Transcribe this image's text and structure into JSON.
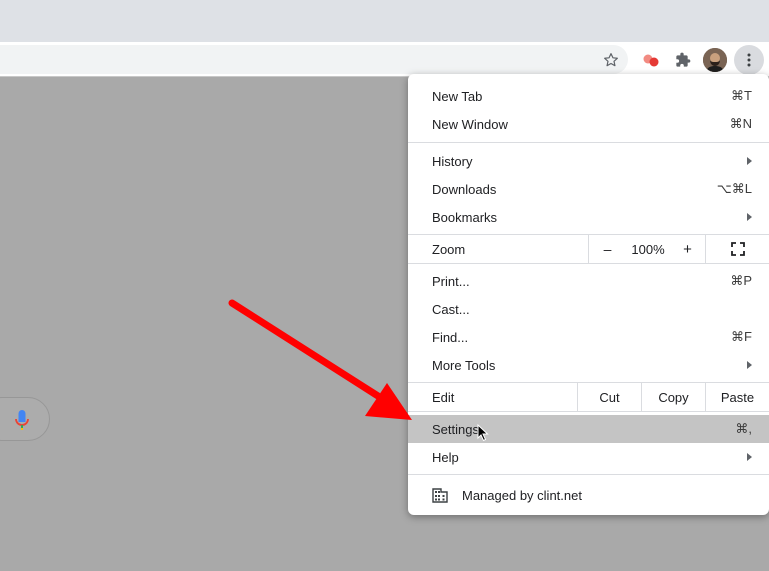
{
  "toolbar": {
    "icons": [
      "star-icon",
      "extension-red-icon",
      "puzzle-icon",
      "avatar",
      "kebab-menu-icon"
    ]
  },
  "menu": {
    "new_tab": {
      "label": "New Tab",
      "shortcut": "⌘T"
    },
    "new_window": {
      "label": "New Window",
      "shortcut": "⌘N"
    },
    "history": {
      "label": "History"
    },
    "downloads": {
      "label": "Downloads",
      "shortcut": "⌥⌘L"
    },
    "bookmarks": {
      "label": "Bookmarks"
    },
    "zoom": {
      "label": "Zoom",
      "minus": "–",
      "value": "100%",
      "plus": "+"
    },
    "print": {
      "label": "Print...",
      "shortcut": "⌘P"
    },
    "cast": {
      "label": "Cast..."
    },
    "find": {
      "label": "Find...",
      "shortcut": "⌘F"
    },
    "more_tools": {
      "label": "More Tools"
    },
    "edit": {
      "label": "Edit",
      "cut": "Cut",
      "copy": "Copy",
      "paste": "Paste"
    },
    "settings": {
      "label": "Settings",
      "shortcut": "⌘,"
    },
    "help": {
      "label": "Help"
    },
    "managed": {
      "label": "Managed by clint.net"
    }
  },
  "colors": {
    "annotation_arrow": "#ff0000",
    "highlight": "#c4c4c4",
    "backdrop": "#a9a9a9"
  }
}
